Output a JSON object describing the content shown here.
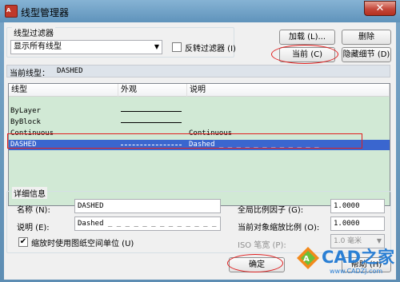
{
  "window": {
    "title": "线型管理器",
    "close_glyph": "✕"
  },
  "filter": {
    "group_label": "线型过滤器",
    "select_value": "显示所有线型",
    "invert_label": "反转过滤器 (I)"
  },
  "buttons": {
    "load": "加载 (L)...",
    "delete": "删除",
    "current": "当前 (C)",
    "hide_details": "隐藏细节 (D)",
    "ok": "确定",
    "help": "帮助 (H)"
  },
  "current_linetype": {
    "label": "当前线型：",
    "value": "DASHED"
  },
  "table": {
    "columns": [
      "线型",
      "外观",
      "说明"
    ],
    "rows": [
      {
        "name": "ByLayer",
        "description": "",
        "appearance": "solid",
        "selected": false
      },
      {
        "name": "ByBlock",
        "description": "",
        "appearance": "solid",
        "selected": false
      },
      {
        "name": "Continuous",
        "description": "Continuous",
        "appearance": "solid",
        "selected": false
      },
      {
        "name": "DASHED",
        "description": "Dashed _ _ _ _ _ _ _ _ _ _ _ _",
        "appearance": "dashed",
        "selected": true
      }
    ]
  },
  "details": {
    "group_label": "详细信息",
    "name_label": "名称 (N):",
    "name_value": "DASHED",
    "desc_label": "说明 (E):",
    "desc_value": "Dashed _ _ _ _ _ _ _ _ _ _ _ _ _",
    "paper_space_label": "缩放时使用图纸空间单位 (U)",
    "paper_space_checked": true,
    "global_scale_label": "全局比例因子 (G):",
    "global_scale_value": "1.0000",
    "object_scale_label": "当前对象缩放比例 (O):",
    "object_scale_value": "1.0000",
    "iso_pen_label": "ISO 笔宽 (P):",
    "iso_pen_value": "1.0 毫米"
  },
  "watermark": {
    "text": "CAD之家",
    "url": "www.CADZJ.com"
  },
  "colors": {
    "selection": "#3a66cf",
    "list_background": "#d1e9d5",
    "annotation": "#e01e1e"
  }
}
